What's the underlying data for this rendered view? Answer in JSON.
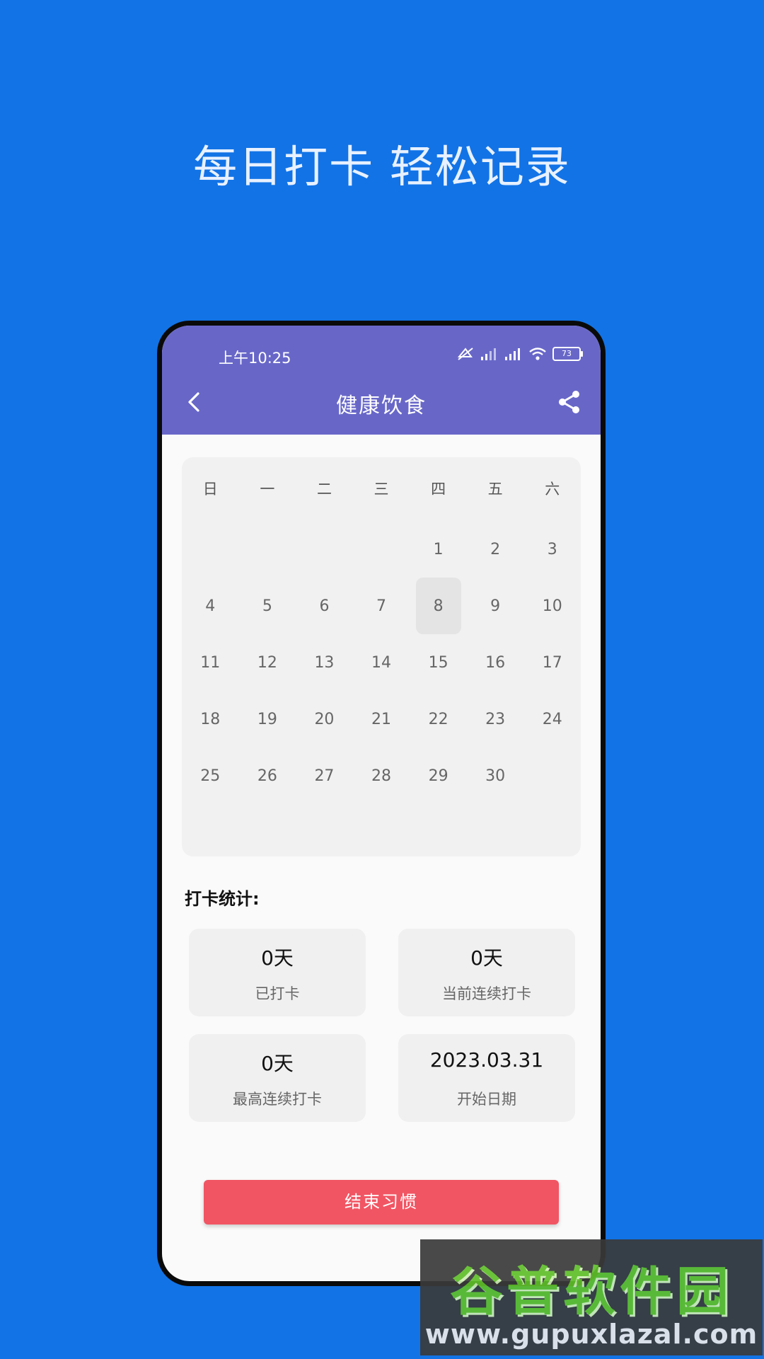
{
  "headline": "每日打卡 轻松记录",
  "status_bar": {
    "time": "上午10:25",
    "battery": "73"
  },
  "app_bar": {
    "title": "健康饮食"
  },
  "calendar": {
    "weekdays": [
      "日",
      "一",
      "二",
      "三",
      "四",
      "五",
      "六"
    ],
    "weeks": [
      [
        "",
        "",
        "",
        "",
        "1",
        "2",
        "3"
      ],
      [
        "4",
        "5",
        "6",
        "7",
        "8",
        "9",
        "10"
      ],
      [
        "11",
        "12",
        "13",
        "14",
        "15",
        "16",
        "17"
      ],
      [
        "18",
        "19",
        "20",
        "21",
        "22",
        "23",
        "24"
      ],
      [
        "25",
        "26",
        "27",
        "28",
        "29",
        "30",
        ""
      ]
    ],
    "today": "8"
  },
  "stats": {
    "title": "打卡统计:",
    "cards": [
      {
        "value": "0天",
        "label": "已打卡"
      },
      {
        "value": "0天",
        "label": "当前连续打卡"
      },
      {
        "value": "0天",
        "label": "最高连续打卡"
      },
      {
        "value": "2023.03.31",
        "label": "开始日期"
      }
    ]
  },
  "end_button": "结束习惯",
  "watermark": {
    "logo": "谷普软件园",
    "url": "www.gupuxlazal.com"
  },
  "colors": {
    "background": "#1273e6",
    "app_bar": "#6867c8",
    "end_button": "#f15563"
  }
}
